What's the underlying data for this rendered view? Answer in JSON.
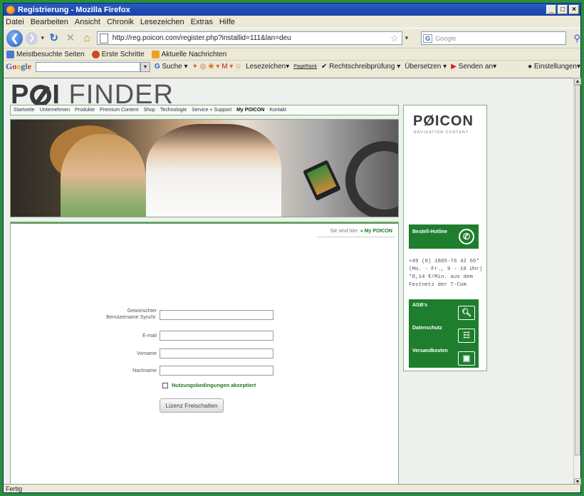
{
  "window": {
    "title": "Registrierung - Mozilla Firefox",
    "minimize": "_",
    "maximize": "□",
    "close": "×"
  },
  "menu": [
    "Datei",
    "Bearbeiten",
    "Ansicht",
    "Chronik",
    "Lesezeichen",
    "Extras",
    "Hilfe"
  ],
  "nav": {
    "url": "http://reg.poicon.com/register.php?installid=111&lan=deu",
    "search_placeholder": "Google",
    "search_engine": "G"
  },
  "bookmarks": [
    "Meistbesuchte Seiten",
    "Erste Schritte",
    "Aktuelle Nachrichten"
  ],
  "google_toolbar": {
    "logo": "Google",
    "search": "Suche",
    "bookmarks": "Lesezeichen",
    "pagerank": "PageRank",
    "spellcheck": "Rechtschreibprüfung",
    "translate": "Übersetzen",
    "send": "Senden an",
    "settings": "Einstellungen"
  },
  "site": {
    "logo_poi": "PØI",
    "logo_finder": "FINDER",
    "topnav": [
      "Startseite",
      "Unternehmen",
      "Produkte",
      "Premium Content",
      "Shop",
      "Technologie",
      "Service + Support",
      "My POICON",
      "Kontakt"
    ],
    "breadcrumb_prefix": "Sie sind hier:",
    "breadcrumb_page": "My POICON",
    "form": {
      "username_label_1": "Gewünschter",
      "username_label_2": "Benutzername Synchr.",
      "email_label": "E-mail",
      "firstname_label": "Vorname",
      "lastname_label": "Nachname",
      "agree_label": "Nutzungsbedingungen akzeptiert",
      "submit_label": "Lizenz Freischalten"
    },
    "sidebar": {
      "poicon_logo": "PØICON",
      "poicon_sub": "NAVIGATION CONTENT",
      "hotline_label": "Bestell-Hotline",
      "hotline_text": "+49 (0) 1805-76 42 66* (Mo. - Fr., 9 - 18 Uhr) *0,14 €/Min. aus dem Festnetz der T-Com",
      "agb": "AGB's",
      "datenschutz": "Datenschutz",
      "versandkosten": "Versandkosten"
    }
  },
  "status": "Fertig"
}
